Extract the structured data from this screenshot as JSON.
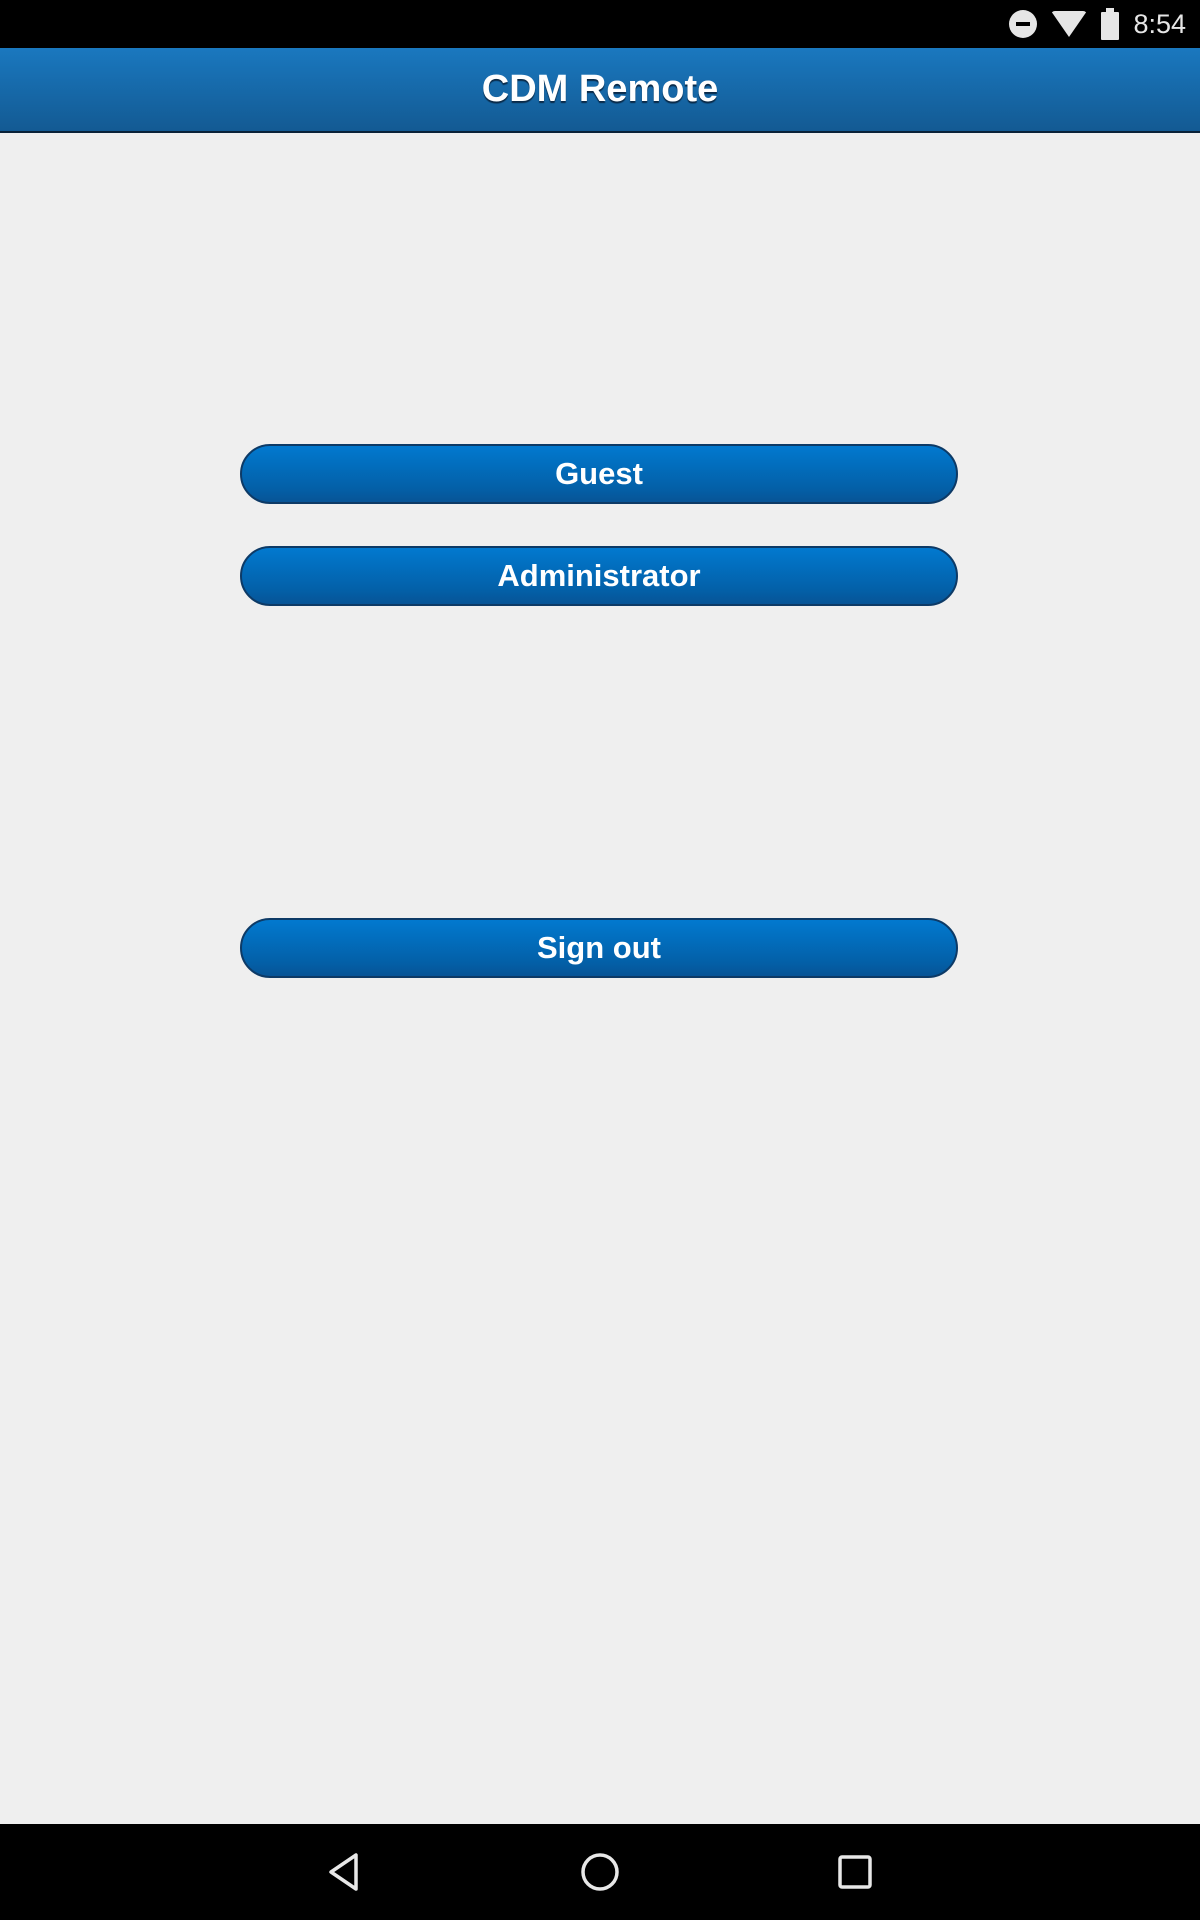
{
  "status_bar": {
    "time": "8:54",
    "icons": [
      "do-not-disturb-icon",
      "wifi-icon",
      "battery-icon"
    ]
  },
  "header": {
    "title": "CDM Remote"
  },
  "buttons": {
    "guest": "Guest",
    "administrator": "Administrator",
    "sign_out": "Sign out"
  },
  "nav_bar": {
    "icons": [
      "back-icon",
      "home-icon",
      "recents-icon"
    ]
  },
  "colors": {
    "header": "#1a78bf",
    "button": "#0279cf",
    "background": "#efefef"
  }
}
